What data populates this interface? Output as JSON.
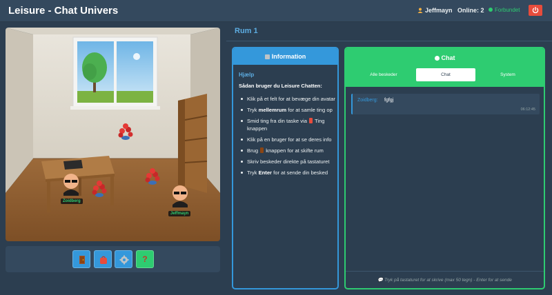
{
  "app": {
    "title": "Leisure - Chat Univers"
  },
  "header": {
    "username": "Jeffmayn",
    "online_label": "Online: 2",
    "status_label": "Forbundet",
    "logout_icon": "power-icon",
    "colors": {
      "status": "#2ecc71",
      "logout": "#e74c3c"
    }
  },
  "room": {
    "name": "Rum 1",
    "avatars": [
      {
        "name": "Zoidberg"
      },
      {
        "name": "Jeffmayn"
      }
    ],
    "items": [
      "flowers",
      "flowers",
      "flowers"
    ]
  },
  "toolbar": {
    "buttons": [
      {
        "icon": "door-icon",
        "color": "#3498db"
      },
      {
        "icon": "bag-icon",
        "color": "#3498db"
      },
      {
        "icon": "gear-icon",
        "color": "#3498db"
      },
      {
        "icon": "question-icon",
        "label": "?",
        "color": "#2ecc71"
      }
    ]
  },
  "info": {
    "header": "Information",
    "help_title": "Hjælp",
    "help_subtitle": "Sådan bruger du Leisure Chatten:",
    "items": [
      {
        "pre": "Klik på et felt for at bevæge din avatar"
      },
      {
        "pre": "Tryk ",
        "bold": "mellemrum",
        "post": " for at samle ting op"
      },
      {
        "pre": "Smid ting fra din taske via ",
        "post": " Ting knappen"
      },
      {
        "pre": "Klik på en bruger for at se deres info"
      },
      {
        "pre": "Brug ",
        "post": " knappen for at skifte rum"
      },
      {
        "pre": "Skriv beskeder direkte på tastaturet"
      },
      {
        "pre": "Tryk ",
        "bold": "Enter",
        "post": " for at sende din besked"
      }
    ]
  },
  "chat": {
    "header": "Chat",
    "tabs": [
      {
        "label": "Alle beskeder",
        "active": false
      },
      {
        "label": "Chat",
        "active": true
      },
      {
        "label": "System",
        "active": false
      }
    ],
    "messages": [
      {
        "user": "Zoidberg:",
        "text": "fgfgj",
        "time": "06:12:45"
      }
    ],
    "footer_hint": "Tryk på tastaturet for at skrive (max 50 tegn) - Enter for at sende"
  }
}
